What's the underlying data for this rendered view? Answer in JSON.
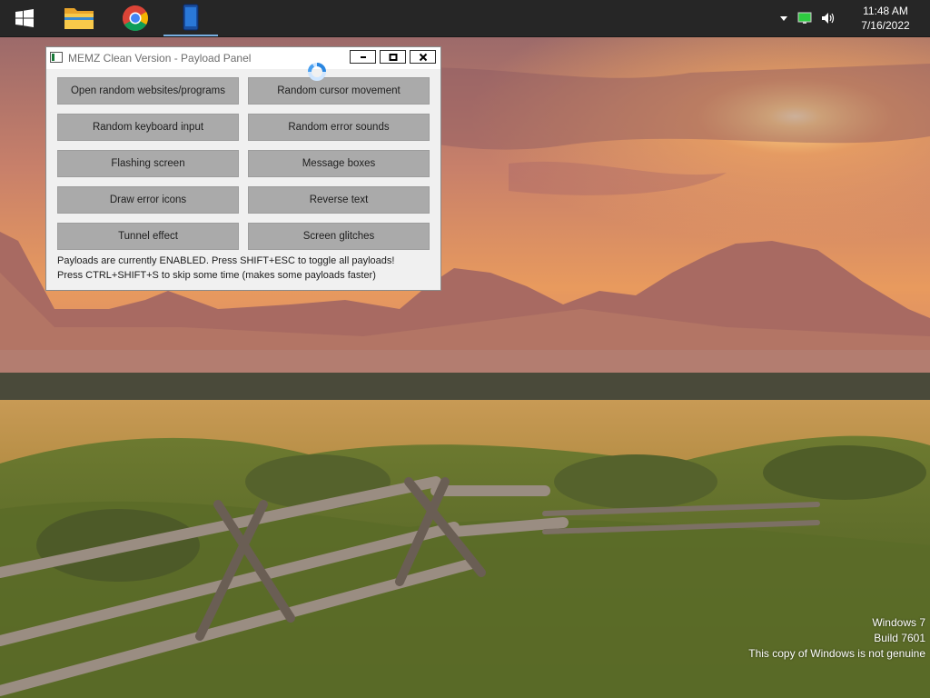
{
  "taskbar": {
    "start_icon": "windows-logo-icon",
    "pinned": [
      {
        "name": "file-explorer",
        "icon": "folder-icon"
      },
      {
        "name": "chrome",
        "icon": "chrome-icon"
      },
      {
        "name": "memz",
        "icon": "app-icon"
      }
    ],
    "tray": {
      "chevron_icon": "chevron-up-icon",
      "network_icon": "network-icon",
      "volume_icon": "volume-icon",
      "time": "11:48 AM",
      "date": "7/16/2022"
    }
  },
  "window": {
    "title": "MEMZ Clean Version - Payload Panel",
    "buttons": [
      {
        "label": "Open random websites/programs"
      },
      {
        "label": "Random cursor movement"
      },
      {
        "label": "Random keyboard input"
      },
      {
        "label": "Random error sounds"
      },
      {
        "label": "Flashing screen"
      },
      {
        "label": "Message boxes"
      },
      {
        "label": "Draw error icons"
      },
      {
        "label": "Reverse text"
      },
      {
        "label": "Tunnel effect"
      },
      {
        "label": "Screen glitches"
      }
    ],
    "status_line1": "Payloads are currently ENABLED. Press SHIFT+ESC to toggle all payloads!",
    "status_line2": "Press CTRL+SHIFT+S to skip some time (makes some payloads faster)"
  },
  "watermark": {
    "line1": "Windows 7",
    "line2": "Build 7601",
    "line3": "This copy of Windows is not genuine"
  },
  "colors": {
    "taskbar_bg": "#262626",
    "window_bg": "#f0f0f0",
    "button_bg": "#aaaaaa"
  }
}
